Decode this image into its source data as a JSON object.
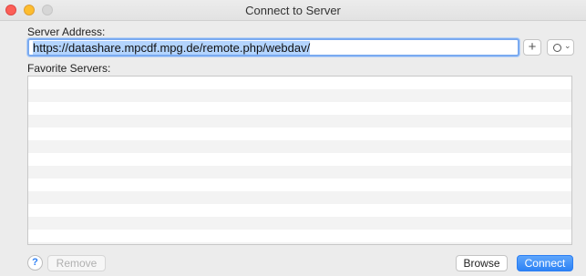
{
  "window": {
    "title": "Connect to Server"
  },
  "server": {
    "label": "Server Address:",
    "address": "https://datashare.mpcdf.mpg.de/remote.php/webdav/"
  },
  "favorites": {
    "label": "Favorite Servers:",
    "items": []
  },
  "buttons": {
    "plus_label": "+",
    "help_label": "?",
    "remove_label": "Remove",
    "browse_label": "Browse",
    "connect_label": "Connect"
  },
  "icons": {
    "recent": "clock-icon",
    "dropdown": "chevron-down-icon"
  },
  "colors": {
    "accent": "#2d82f5",
    "close": "#fc5f57",
    "minimize": "#fdbd2e",
    "maximize": "#d6d6d6"
  }
}
